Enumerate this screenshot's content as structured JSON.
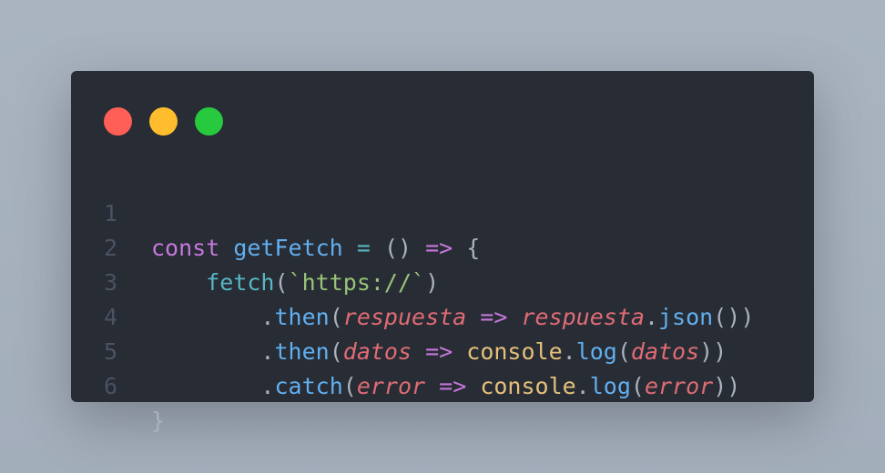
{
  "window": {
    "controls": {
      "close_color": "#ff5f56",
      "minimize_color": "#ffbd2e",
      "maximize_color": "#27c93f"
    }
  },
  "code": {
    "lines": [
      {
        "number": "1",
        "tokens": [
          "const",
          " ",
          "getFetch",
          " ",
          "=",
          " ",
          "()",
          " ",
          "=>",
          " ",
          "{"
        ]
      },
      {
        "number": "2",
        "tokens": [
          "    ",
          "fetch",
          "(",
          "`",
          "https://",
          "`",
          ")"
        ]
      },
      {
        "number": "3",
        "tokens": [
          "        ",
          ".",
          "then",
          "(",
          "respuesta",
          " ",
          "=>",
          " ",
          "respuesta",
          ".",
          "json",
          "())"
        ]
      },
      {
        "number": "4",
        "tokens": [
          "        ",
          ".",
          "then",
          "(",
          "datos",
          " ",
          "=>",
          " ",
          "console",
          ".",
          "log",
          "(",
          "datos",
          "))"
        ]
      },
      {
        "number": "5",
        "tokens": [
          "        ",
          ".",
          "catch",
          "(",
          "error",
          " ",
          "=>",
          " ",
          "console",
          ".",
          "log",
          "(",
          "error",
          "))"
        ]
      },
      {
        "number": "6",
        "tokens": [
          "}"
        ]
      }
    ]
  }
}
